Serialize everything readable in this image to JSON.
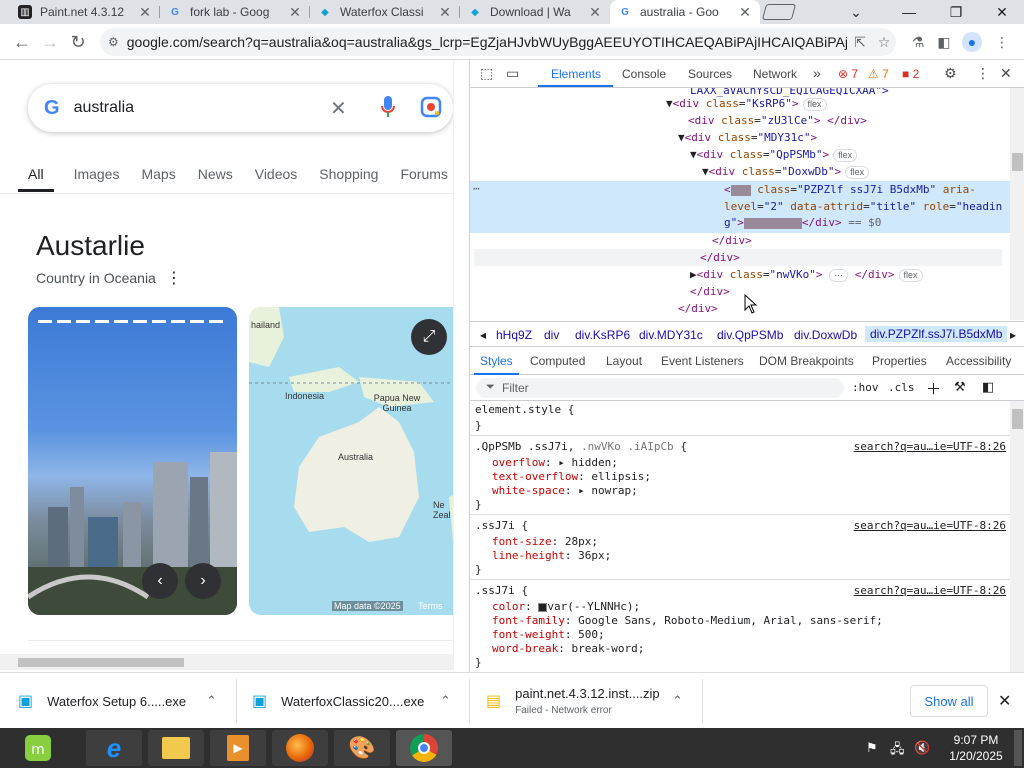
{
  "tabs": [
    {
      "title": "Paint.net 4.3.12",
      "icon": "paintnet-icon"
    },
    {
      "title": "fork lab - Goog",
      "icon": "google-icon"
    },
    {
      "title": "Waterfox Classi",
      "icon": "waterfox-icon"
    },
    {
      "title": "Download | Wa",
      "icon": "waterfox-icon"
    },
    {
      "title": "australia - Goo",
      "icon": "google-icon",
      "active": true
    }
  ],
  "address": {
    "url": "google.com/search?q=australia&oq=australia&gs_lcrp=EgZjaHJvbWUyBggAEEUYOTIHCAEQABiPAjIHCAIQABiPAjI..."
  },
  "google": {
    "query": "australia",
    "tabs": [
      "All",
      "Images",
      "Maps",
      "News",
      "Videos",
      "Shopping",
      "Forums"
    ],
    "kp_title": "Austarlie",
    "kp_subtitle": "Country in Oceania",
    "map_labels": {
      "thailand": "hailand",
      "indonesia": "Indonesia",
      "png": "Papua New Guinea",
      "australia": "Australia",
      "nz": "Ne Zeal",
      "mapdata": "Map data ©2025",
      "terms": "Terms"
    }
  },
  "devtools": {
    "tabs": [
      "Elements",
      "Console",
      "Sources",
      "Network"
    ],
    "errors": "7",
    "warnings": "7",
    "issues": "2",
    "elements": {
      "top_partial": "LAXX_aVACnYsCD_EQICAGEQICXAA\">",
      "ksrp6": "KsRP6",
      "zu3lce": "zU3lCe",
      "mdy31c": "MDY31c",
      "qppsmb": "QpPSMb",
      "doxwdb": "DoxwDb",
      "sel_class": "PZPZlf ssJ7i B5dxMb",
      "sel_aria": "2",
      "sel_attrid": "title",
      "sel_role": "heading",
      "eq": "== $0",
      "nwvko": "nwVKo",
      "flex": "flex"
    },
    "breadcrumbs": [
      "hHq9Z",
      "div",
      "div.KsRP6",
      "div.MDY31c",
      "div.QpPSMb",
      "div.DoxwDb",
      "div.PZPZlf.ssJ7i.B5dxMb"
    ],
    "styles_tabs": [
      "Styles",
      "Computed",
      "Layout",
      "Event Listeners",
      "DOM Breakpoints",
      "Properties",
      "Accessibility"
    ],
    "filter_placeholder": "Filter",
    "hov": ":hov",
    "cls": ".cls",
    "rules": [
      {
        "selector": "element.style {",
        "src": "",
        "props": []
      },
      {
        "selector": ".QpPSMb .ssJ7i, .nwVKo .iAIpCb {",
        "src": "search?q=au…ie=UTF-8:26",
        "props": [
          [
            "overflow",
            "hidden"
          ],
          [
            "text-overflow",
            "ellipsis"
          ],
          [
            "white-space",
            "nowrap"
          ]
        ]
      },
      {
        "selector": ".ssJ7i {",
        "src": "search?q=au…ie=UTF-8:26",
        "props": [
          [
            "font-size",
            "28px"
          ],
          [
            "line-height",
            "36px"
          ]
        ]
      },
      {
        "selector": ".ssJ7i {",
        "src": "search?q=au…ie=UTF-8:26",
        "props": [
          [
            "color",
            "var(--YLNNHc)"
          ],
          [
            "font-family",
            "Google Sans, Roboto-Medium, Arial, sans-serif"
          ],
          [
            "font-weight",
            "500"
          ],
          [
            "word-break",
            "break-word"
          ]
        ]
      }
    ]
  },
  "downloads": [
    {
      "name": "Waterfox Setup 6.....exe",
      "status": ""
    },
    {
      "name": "WaterfoxClassic20....exe",
      "status": ""
    },
    {
      "name": "paint.net.4.3.12.inst....zip",
      "status": "Failed - Network error"
    }
  ],
  "show_all": "Show all",
  "clock": {
    "time": "9:07 PM",
    "date": "1/20/2025"
  },
  "colors": {
    "accent": "#1a73e8",
    "error": "#d93025",
    "warning": "#e37400"
  }
}
